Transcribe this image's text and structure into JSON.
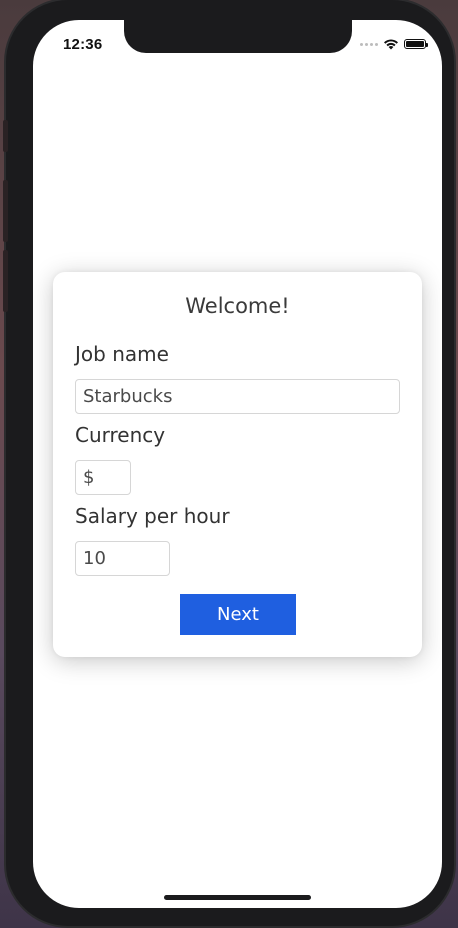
{
  "status_bar": {
    "time": "12:36",
    "icons": [
      "signal-dots-icon",
      "wifi-icon",
      "battery-icon"
    ]
  },
  "welcome_card": {
    "title": "Welcome!",
    "fields": {
      "job_name": {
        "label": "Job name",
        "value": "Starbucks"
      },
      "currency": {
        "label": "Currency",
        "value": "$"
      },
      "salary": {
        "label": "Salary per hour",
        "value": "10"
      }
    },
    "next_label": "Next"
  },
  "colors": {
    "accent": "#1f5fe0",
    "card_background": "#ffffff",
    "text": "#333333"
  }
}
